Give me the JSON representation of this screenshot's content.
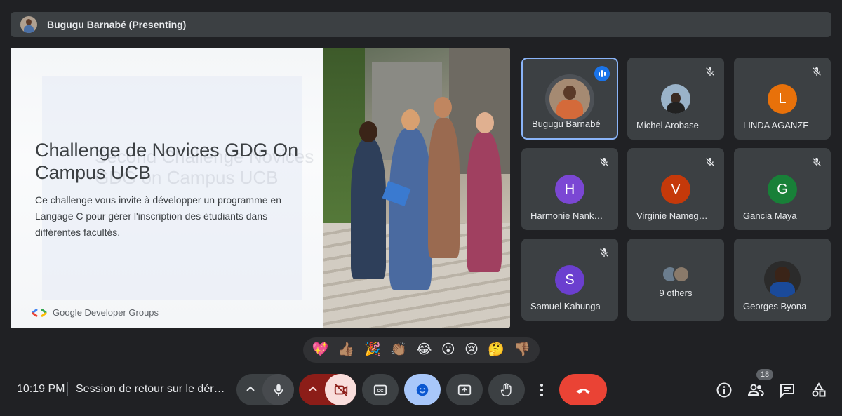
{
  "presenter_bar": {
    "name": "Bugugu Barnabé (Presenting)"
  },
  "slide": {
    "title": "Challenge de Novices GDG On Campus UCB",
    "description": "Ce challenge vous invite à développer un programme en Langage C pour gérer l'inscription des étudiants dans différentes facultés.",
    "ghost_text": "Second Challenge Novices GDG on Campus UCB",
    "logo_text": "Google Developer Groups"
  },
  "participants": [
    {
      "name": "Bugugu Barnabé",
      "initial": "",
      "color": "#6b5a4e",
      "speaking": true
    },
    {
      "name": "Michel Arobase",
      "initial": "",
      "color": "#7a8da0",
      "speaking": false
    },
    {
      "name": "LINDA AGANZE",
      "initial": "L",
      "color": "#e8710a",
      "speaking": false
    },
    {
      "name": "Harmonie Nank…",
      "initial": "H",
      "color": "#7b47d4",
      "speaking": false
    },
    {
      "name": "Virginie Nameg…",
      "initial": "V",
      "color": "#c5390a",
      "speaking": false
    },
    {
      "name": "Gancia Maya",
      "initial": "G",
      "color": "#188038",
      "speaking": false
    },
    {
      "name": "Samuel Kahunga",
      "initial": "S",
      "color": "#6b3fcf",
      "speaking": false
    },
    {
      "name": "9 others",
      "initial": "",
      "color": "#5f6368",
      "speaking": false
    },
    {
      "name": "Georges Byona",
      "initial": "",
      "color": "#2b2b2b",
      "speaking": false
    }
  ],
  "reactions": [
    "💖",
    "👍🏽",
    "🎉",
    "👏🏽",
    "😂",
    "😮",
    "😢",
    "🤔",
    "👎🏽"
  ],
  "bottom_bar": {
    "time": "10:19 PM",
    "meeting_name": "Session de retour sur le dér…",
    "people_count": "18"
  },
  "colors": {
    "background": "#202124",
    "tile": "#3c4043",
    "active_border": "#8ab4f8",
    "end_call": "#ea4335",
    "camera_off_bg": "#f9dedc",
    "camera_dropdown_bg": "#8c1d18",
    "reaction_active_bg": "#a8c7fa"
  }
}
